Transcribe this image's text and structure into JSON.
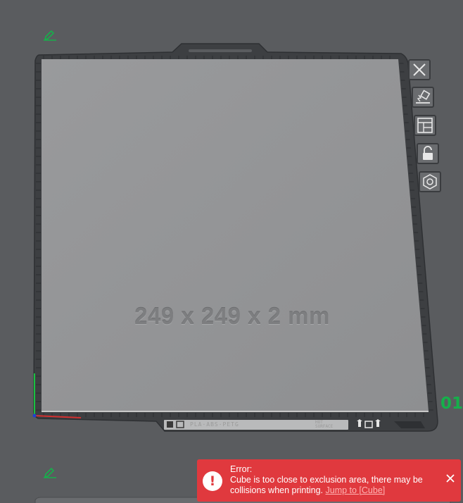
{
  "plate": {
    "number": "01",
    "dimensions": "249 x 249 x 2 mm",
    "filament_label": "PLA·ABS·PETG",
    "surface_label": [
      "HOT",
      "SURFACE"
    ]
  },
  "toolbar": {
    "buttons": [
      {
        "icon": "close-x-icon"
      },
      {
        "icon": "auto-orient-icon"
      },
      {
        "icon": "arrange-icon"
      },
      {
        "icon": "lock-icon"
      },
      {
        "icon": "plate-settings-icon"
      }
    ]
  },
  "error": {
    "title": "Error:",
    "message": "Cube is too close to exclusion area, there may be collisions when printing.",
    "link": "Jump to [Cube]"
  },
  "colors": {
    "background": "#5a5c5f",
    "plate_surface": "#949597",
    "plate_frame": "#3d3f42",
    "accent_green": "#16b04b",
    "error_red": "#e0393e"
  }
}
